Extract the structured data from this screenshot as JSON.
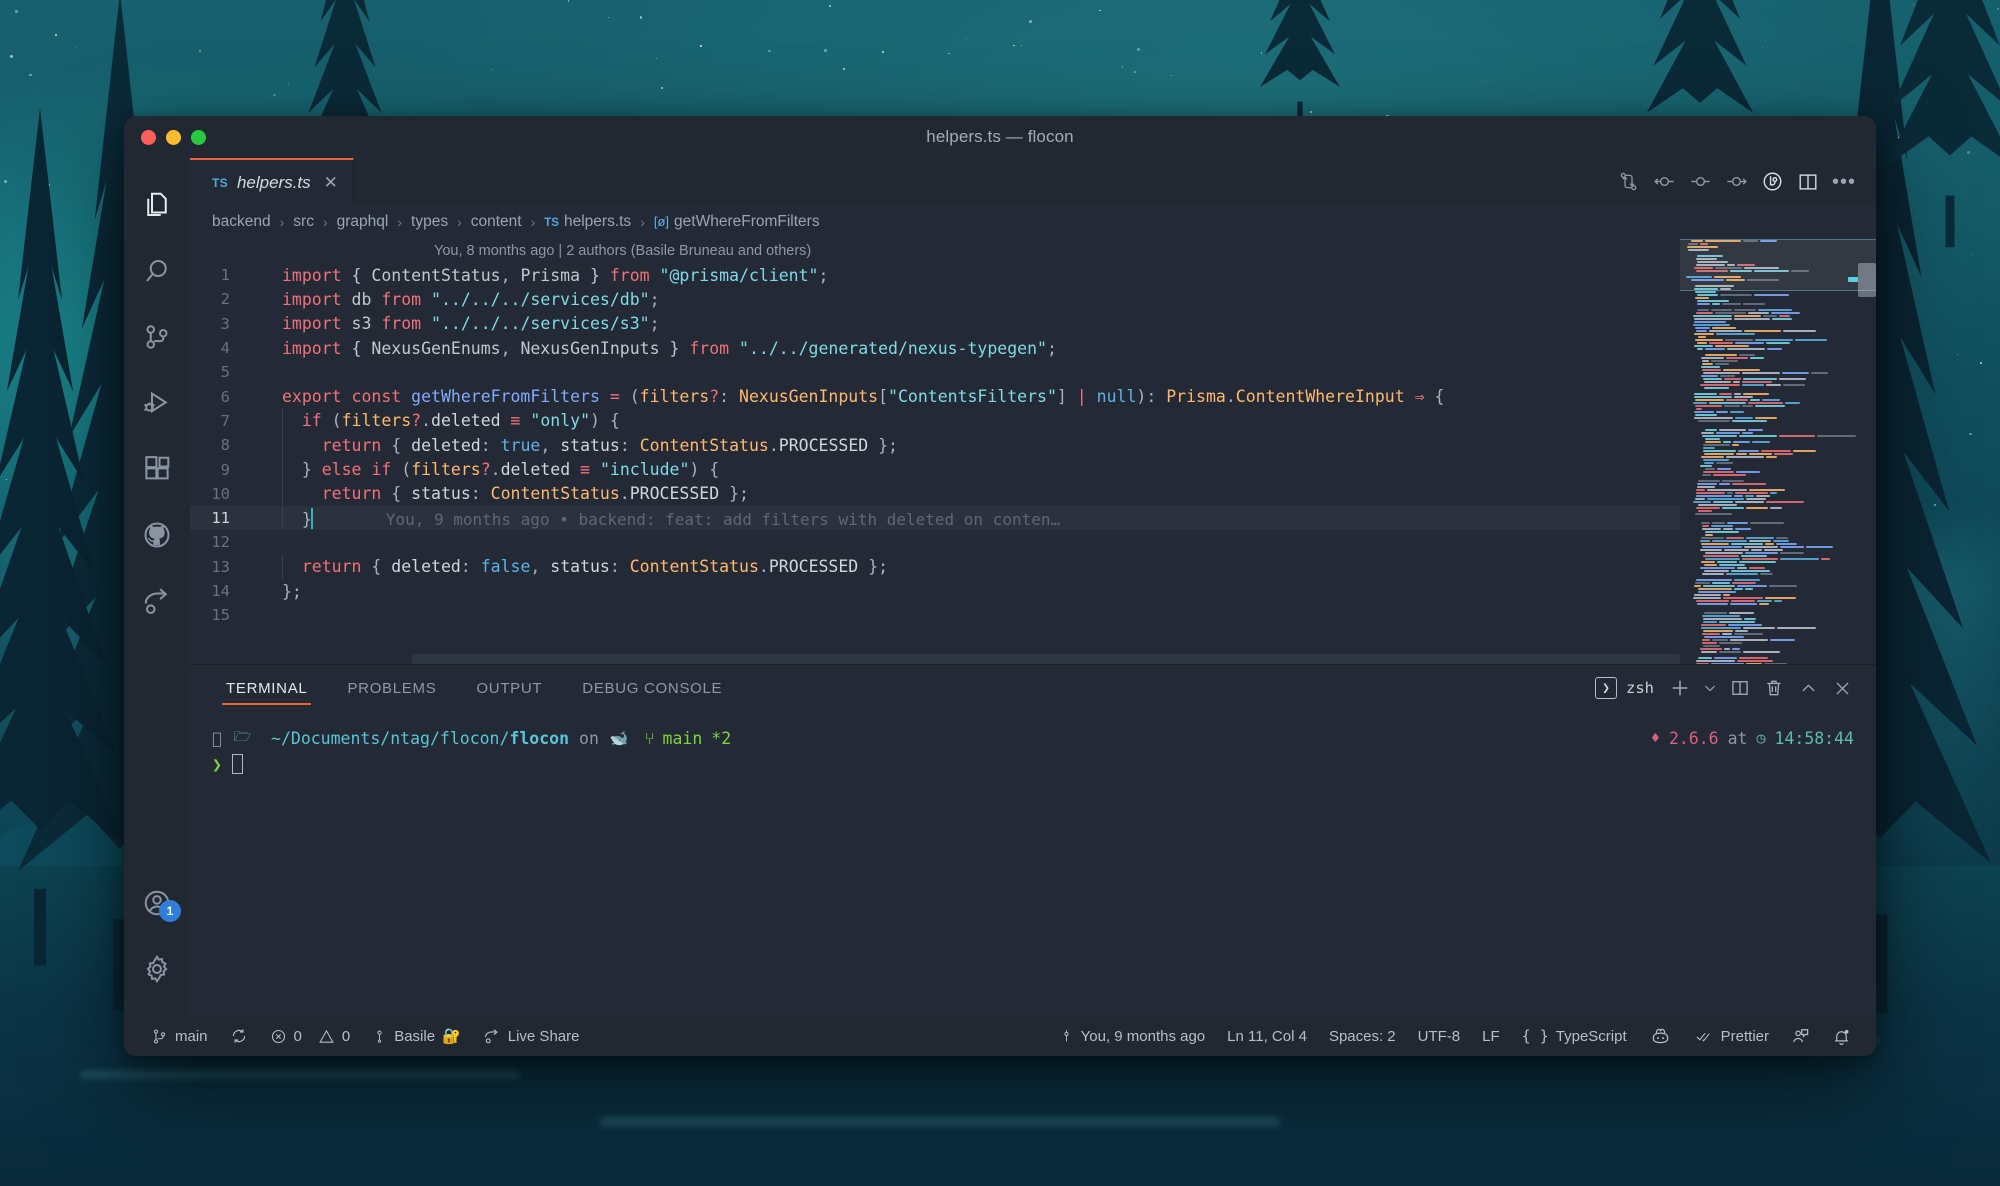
{
  "window": {
    "title": "helpers.ts — flocon",
    "traffic_lights": [
      "close-red",
      "minimize-yellow",
      "maximize-green"
    ]
  },
  "activity_bar": {
    "items": [
      {
        "name": "explorer",
        "icon": "files-icon",
        "active": true
      },
      {
        "name": "search",
        "icon": "search-icon",
        "active": false
      },
      {
        "name": "source-control",
        "icon": "source-control-icon",
        "active": false
      },
      {
        "name": "run-and-debug",
        "icon": "run-debug-icon",
        "active": false
      },
      {
        "name": "extensions",
        "icon": "extensions-icon",
        "active": false
      },
      {
        "name": "github",
        "icon": "github-icon",
        "active": false
      },
      {
        "name": "live-share",
        "icon": "live-share-icon",
        "active": false
      }
    ],
    "bottom": [
      {
        "name": "accounts",
        "icon": "account-icon",
        "badge": "1"
      },
      {
        "name": "manage",
        "icon": "gear-icon",
        "badge": ""
      }
    ]
  },
  "tab": {
    "file_type": "TS",
    "label": "helpers.ts",
    "close": "✕",
    "accent_color": "#f0603c"
  },
  "editor_actions": [
    {
      "name": "open-changes",
      "icon": "git-compare-icon"
    },
    {
      "name": "previous-change",
      "icon": "arrow-circle-left-icon"
    },
    {
      "name": "change-indicator",
      "icon": "circle-dash-icon"
    },
    {
      "name": "next-change",
      "icon": "arrow-circle-right-icon"
    },
    {
      "name": "file-history",
      "icon": "git-history-icon"
    },
    {
      "name": "split-editor",
      "icon": "split-editor-icon"
    },
    {
      "name": "more-actions",
      "icon": "ellipsis-icon"
    }
  ],
  "breadcrumbs": {
    "separator": "›",
    "items": [
      {
        "label": "backend",
        "icon": ""
      },
      {
        "label": "src",
        "icon": ""
      },
      {
        "label": "graphql",
        "icon": ""
      },
      {
        "label": "types",
        "icon": ""
      },
      {
        "label": "content",
        "icon": ""
      },
      {
        "label": "helpers.ts",
        "icon": "TS"
      },
      {
        "label": "getWhereFromFilters",
        "icon": "symbol-function-icon"
      }
    ]
  },
  "editor": {
    "blame_header": "You, 8 months ago | 2 authors (Basile Bruneau and others)",
    "inline_blame": "You, 9 months ago • backend: feat: add filters with deleted on conten…",
    "current_line": 11,
    "lines": [
      {
        "n": 1,
        "tokens": [
          [
            "kw",
            "import"
          ],
          [
            "plain",
            " { "
          ],
          [
            "plain",
            "ContentStatus"
          ],
          [
            "punc",
            ", "
          ],
          [
            "plain",
            "Prisma"
          ],
          [
            "plain",
            " } "
          ],
          [
            "kw",
            "from"
          ],
          [
            "punc",
            " "
          ],
          [
            "str",
            "\"@prisma/client\""
          ],
          [
            "punc",
            ";"
          ]
        ]
      },
      {
        "n": 2,
        "tokens": [
          [
            "kw",
            "import"
          ],
          [
            "plain",
            " db "
          ],
          [
            "kw",
            "from"
          ],
          [
            "punc",
            " "
          ],
          [
            "str",
            "\"../../../services/db\""
          ],
          [
            "punc",
            ";"
          ]
        ]
      },
      {
        "n": 3,
        "tokens": [
          [
            "kw",
            "import"
          ],
          [
            "plain",
            " s3 "
          ],
          [
            "kw",
            "from"
          ],
          [
            "punc",
            " "
          ],
          [
            "str",
            "\"../../../services/s3\""
          ],
          [
            "punc",
            ";"
          ]
        ]
      },
      {
        "n": 4,
        "tokens": [
          [
            "kw",
            "import"
          ],
          [
            "plain",
            " { "
          ],
          [
            "plain",
            "NexusGenEnums"
          ],
          [
            "punc",
            ", "
          ],
          [
            "plain",
            "NexusGenInputs"
          ],
          [
            "plain",
            " } "
          ],
          [
            "kw",
            "from"
          ],
          [
            "punc",
            " "
          ],
          [
            "str",
            "\"../../generated/nexus-typegen\""
          ],
          [
            "punc",
            ";"
          ]
        ]
      },
      {
        "n": 5,
        "tokens": []
      },
      {
        "n": 6,
        "tokens": [
          [
            "kw",
            "export"
          ],
          [
            "punc",
            " "
          ],
          [
            "kw",
            "const"
          ],
          [
            "punc",
            " "
          ],
          [
            "fn",
            "getWhereFromFilters"
          ],
          [
            "punc",
            " "
          ],
          [
            "op",
            "="
          ],
          [
            "punc",
            " ("
          ],
          [
            "param",
            "filters"
          ],
          [
            "op",
            "?"
          ],
          [
            "punc",
            ": "
          ],
          [
            "type",
            "NexusGenInputs"
          ],
          [
            "punc",
            "["
          ],
          [
            "str",
            "\"ContentsFilters\""
          ],
          [
            "punc",
            "]"
          ],
          [
            "op",
            " | "
          ],
          [
            "bool",
            "null"
          ],
          [
            "punc",
            "): "
          ],
          [
            "type",
            "Prisma"
          ],
          [
            "punc",
            "."
          ],
          [
            "type",
            "ContentWhereInput"
          ],
          [
            "arrow",
            " ⇒ "
          ],
          [
            "punc",
            "{"
          ]
        ]
      },
      {
        "n": 7,
        "tokens": [
          [
            "punc",
            "  "
          ],
          [
            "kw",
            "if"
          ],
          [
            "punc",
            " ("
          ],
          [
            "param",
            "filters"
          ],
          [
            "op",
            "?"
          ],
          [
            "punc",
            "."
          ],
          [
            "prop",
            "deleted"
          ],
          [
            "op",
            " ≡ "
          ],
          [
            "str",
            "\"only\""
          ],
          [
            "punc",
            ") {"
          ]
        ]
      },
      {
        "n": 8,
        "tokens": [
          [
            "punc",
            "    "
          ],
          [
            "kw",
            "return"
          ],
          [
            "punc",
            " { "
          ],
          [
            "prop",
            "deleted"
          ],
          [
            "punc",
            ": "
          ],
          [
            "bool",
            "true"
          ],
          [
            "punc",
            ", "
          ],
          [
            "prop",
            "status"
          ],
          [
            "punc",
            ": "
          ],
          [
            "type",
            "ContentStatus"
          ],
          [
            "punc",
            "."
          ],
          [
            "prop",
            "PROCESSED"
          ],
          [
            "punc",
            " };"
          ]
        ]
      },
      {
        "n": 9,
        "tokens": [
          [
            "punc",
            "  } "
          ],
          [
            "kw",
            "else"
          ],
          [
            "punc",
            " "
          ],
          [
            "kw",
            "if"
          ],
          [
            "punc",
            " ("
          ],
          [
            "param",
            "filters"
          ],
          [
            "op",
            "?"
          ],
          [
            "punc",
            "."
          ],
          [
            "prop",
            "deleted"
          ],
          [
            "op",
            " ≡ "
          ],
          [
            "str",
            "\"include\""
          ],
          [
            "punc",
            ") {"
          ]
        ]
      },
      {
        "n": 10,
        "tokens": [
          [
            "punc",
            "    "
          ],
          [
            "kw",
            "return"
          ],
          [
            "punc",
            " { "
          ],
          [
            "prop",
            "status"
          ],
          [
            "punc",
            ": "
          ],
          [
            "type",
            "ContentStatus"
          ],
          [
            "punc",
            "."
          ],
          [
            "prop",
            "PROCESSED"
          ],
          [
            "punc",
            " };"
          ]
        ]
      },
      {
        "n": 11,
        "tokens": [
          [
            "punc",
            "  }"
          ]
        ]
      },
      {
        "n": 12,
        "tokens": []
      },
      {
        "n": 13,
        "tokens": [
          [
            "punc",
            "  "
          ],
          [
            "kw",
            "return"
          ],
          [
            "punc",
            " { "
          ],
          [
            "prop",
            "deleted"
          ],
          [
            "punc",
            ": "
          ],
          [
            "bool",
            "false"
          ],
          [
            "punc",
            ", "
          ],
          [
            "prop",
            "status"
          ],
          [
            "punc",
            ": "
          ],
          [
            "type",
            "ContentStatus"
          ],
          [
            "punc",
            "."
          ],
          [
            "prop",
            "PROCESSED"
          ],
          [
            "punc",
            " };"
          ]
        ]
      },
      {
        "n": 14,
        "tokens": [
          [
            "punc",
            "};"
          ]
        ]
      },
      {
        "n": 15,
        "tokens": []
      }
    ]
  },
  "panel": {
    "tabs": [
      {
        "label": "TERMINAL",
        "active": true
      },
      {
        "label": "PROBLEMS",
        "active": false
      },
      {
        "label": "OUTPUT",
        "active": false
      },
      {
        "label": "DEBUG CONSOLE",
        "active": false
      }
    ],
    "terminal_name": "zsh",
    "terminal_glyph": "❯",
    "actions": [
      {
        "name": "new-terminal",
        "icon": "plus-icon"
      },
      {
        "name": "terminal-dropdown",
        "icon": "chevron-down-icon"
      },
      {
        "name": "split-terminal",
        "icon": "split-icon"
      },
      {
        "name": "kill-terminal",
        "icon": "trash-icon"
      },
      {
        "name": "maximize-panel",
        "icon": "chevron-up-icon"
      },
      {
        "name": "close-panel",
        "icon": "close-icon"
      }
    ]
  },
  "terminal": {
    "prompt_path_prefix": "~/Documents/ntag/flocon/",
    "prompt_path_repo": "flocon",
    "on_word": "on",
    "branch": "main",
    "branch_dirty": "*2",
    "ruby_version": "2.6.6",
    "at_word": "at",
    "time": "14:58:44",
    "prompt_symbol": "❯",
    "apple_glyph": "",
    "folder_glyph": "🗀",
    "octocat_glyph": "🐙",
    "branch_glyph": "⑂",
    "gem_glyph": "♦",
    "clock_glyph": "◷"
  },
  "statusbar": {
    "left": [
      {
        "name": "branch",
        "icon": "git-branch-icon",
        "label": "main"
      },
      {
        "name": "sync",
        "icon": "sync-icon",
        "label": ""
      },
      {
        "name": "problems",
        "icon": "errors-warnings-icon",
        "label": "0",
        "label2": "0"
      },
      {
        "name": "account",
        "icon": "person-icon",
        "label": "Basile",
        "emoji": "🔐"
      },
      {
        "name": "live-share",
        "icon": "live-share-icon",
        "label": "Live Share"
      }
    ],
    "right": [
      {
        "name": "file-blame",
        "icon": "git-commit-icon",
        "label": "You, 9 months ago"
      },
      {
        "name": "cursor-position",
        "icon": "",
        "label": "Ln 11, Col 4"
      },
      {
        "name": "indentation",
        "icon": "",
        "label": "Spaces: 2"
      },
      {
        "name": "encoding",
        "icon": "",
        "label": "UTF-8"
      },
      {
        "name": "eol",
        "icon": "",
        "label": "LF"
      },
      {
        "name": "language-mode",
        "icon": "braces-icon",
        "label": "TypeScript"
      },
      {
        "name": "copilot",
        "icon": "copilot-icon",
        "label": ""
      },
      {
        "name": "prettier",
        "icon": "check-check-icon",
        "label": "Prettier"
      },
      {
        "name": "feedback",
        "icon": "feedback-icon",
        "label": ""
      },
      {
        "name": "notifications",
        "icon": "bell-dot-icon",
        "label": ""
      }
    ]
  },
  "colors": {
    "accent": "#f0603c",
    "chrome": "#222832",
    "editor_bg": "#242a35",
    "badge_blue": "#2f7fd8",
    "cursor_teal": "#2bb7b7"
  }
}
